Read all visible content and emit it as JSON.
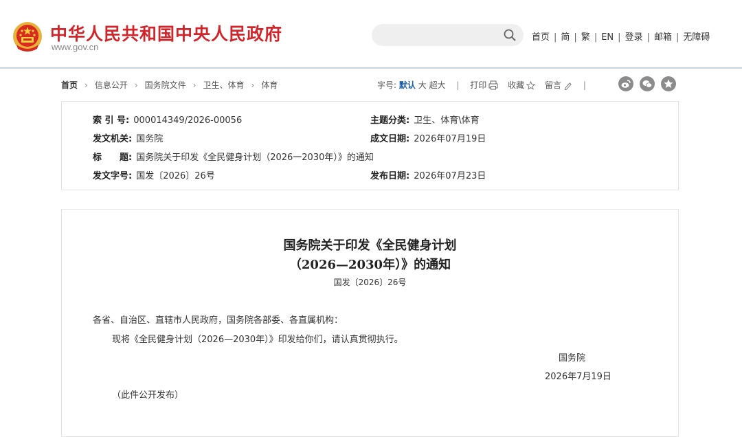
{
  "header": {
    "site_title": "中华人民共和国中央人民政府",
    "site_domain": "www.gov.cn",
    "search_placeholder": "",
    "nav": [
      "首页",
      "简",
      "繁",
      "EN",
      "登录",
      "邮箱",
      "无障碍"
    ]
  },
  "breadcrumb": [
    "首页",
    "信息公开",
    "国务院文件",
    "卫生、体育",
    "体育"
  ],
  "toolbar": {
    "font_size_label": "字号:",
    "font_sizes": [
      "默认",
      "大",
      "超大"
    ],
    "print": "打印",
    "favorite": "收藏",
    "comment": "留言"
  },
  "share_icons": [
    "weibo-icon",
    "wechat-icon",
    "qzone-icon"
  ],
  "meta": {
    "index_label": "索 引 号:",
    "index_value": "000014349/2026-00056",
    "topic_label": "主题分类:",
    "topic_value": "卫生、体育\\体育",
    "issuer_label": "发文机关:",
    "issuer_value": "国务院",
    "date_written_label": "成文日期:",
    "date_written_value": "2026年07月19日",
    "title_label": "标　　题:",
    "title_value": "国务院关于印发《全民健身计划（2026一2030年）》的通知",
    "doc_no_label": "发文字号:",
    "doc_no_value": "国发〔2026〕26号",
    "publish_date_label": "发布日期:",
    "publish_date_value": "2026年07月23日"
  },
  "document": {
    "title_line1": "国务院关于印发《全民健身计划",
    "title_line2": "（2026—2030年）》的通知",
    "doc_number": "国发〔2026〕26号",
    "salutation": "各省、自治区、直辖市人民政府，国务院各部委、各直属机构：",
    "body": "现将《全民健身计划（2026—2030年）》印发给你们，请认真贯彻执行。",
    "signature": "国务院",
    "sign_date": "2026年7月19日",
    "note": "（此件公开发布）"
  },
  "colors": {
    "brand_red": "#d0262b",
    "active_blue": "#1f5ea8",
    "share_gray": "#8b8b8b"
  }
}
